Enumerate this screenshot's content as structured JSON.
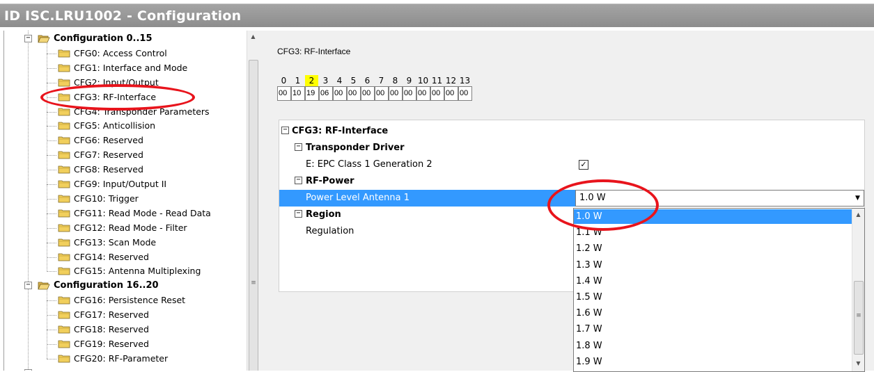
{
  "window": {
    "title": "ID ISC.LRU1002 - Configuration"
  },
  "tree": {
    "groups": [
      {
        "label": "Configuration 0..15",
        "items": [
          "CFG0: Access Control",
          "CFG1: Interface and Mode",
          "CFG2: Input/Output",
          "CFG3: RF-Interface",
          "CFG4: Transponder Parameters",
          "CFG5: Anticollision",
          "CFG6: Reserved",
          "CFG7: Reserved",
          "CFG8: Reserved",
          "CFG9: Input/Output II",
          "CFG10: Trigger",
          "CFG11: Read Mode - Read Data",
          "CFG12: Read Mode - Filter",
          "CFG13: Scan Mode",
          "CFG14: Reserved",
          "CFG15: Antenna Multiplexing"
        ]
      },
      {
        "label": "Configuration 16..20",
        "items": [
          "CFG16: Persistence Reset",
          "CFG17: Reserved",
          "CFG18: Reserved",
          "CFG19: Reserved",
          "CFG20: RF-Parameter"
        ]
      }
    ],
    "selected": "CFG3: RF-Interface"
  },
  "panel": {
    "title": "CFG3: RF-Interface",
    "byte_indices": [
      "0",
      "1",
      "2",
      "3",
      "4",
      "5",
      "6",
      "7",
      "8",
      "9",
      "10",
      "11",
      "12",
      "13"
    ],
    "byte_values": [
      "00",
      "10",
      "19",
      "06",
      "00",
      "00",
      "00",
      "00",
      "00",
      "00",
      "00",
      "00",
      "00",
      "00"
    ],
    "highlighted_index": "2"
  },
  "grid": {
    "root": "CFG3: RF-Interface",
    "cat_transponder": "Transponder Driver",
    "prop_epc": "E: EPC Class 1 Generation 2",
    "epc_checked": true,
    "cat_rfpower": "RF-Power",
    "prop_power": "Power Level Antenna 1",
    "power_value": "1.0 W",
    "cat_region": "Region",
    "prop_regulation": "Regulation"
  },
  "dropdown": {
    "options": [
      "1.0 W",
      "1.1 W",
      "1.2 W",
      "1.3 W",
      "1.4 W",
      "1.5 W",
      "1.6 W",
      "1.7 W",
      "1.8 W",
      "1.9 W"
    ],
    "selected": "1.0 W"
  },
  "glyphs": {
    "minus": "−",
    "check": "✓",
    "arrow_down": "▼",
    "arrow_up": "▲",
    "grip": "≡"
  },
  "colors": {
    "selection": "#3399ff",
    "highlight": "#ffff00",
    "annotation": "#e8141c",
    "titlebar": "#999999"
  }
}
